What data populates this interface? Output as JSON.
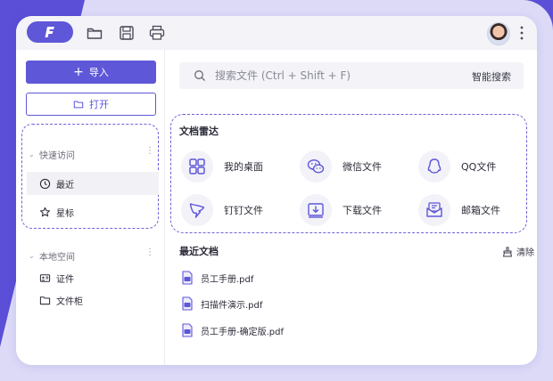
{
  "colors": {
    "accent": "#5e57d8",
    "background_purple": "#5a4fd6",
    "background_light": "#dcdaf7"
  },
  "titlebar": {
    "logo_letter": "F",
    "icons": [
      "folder-icon",
      "save-icon",
      "print-icon"
    ]
  },
  "sidebar": {
    "import_label": "导入",
    "open_label": "打开",
    "quick_access": {
      "title": "快速访问",
      "items": [
        {
          "label": "最近",
          "icon": "clock-icon",
          "active": true
        },
        {
          "label": "星标",
          "icon": "star-icon",
          "active": false
        }
      ]
    },
    "local_space": {
      "title": "本地空间",
      "items": [
        {
          "label": "证件",
          "icon": "id-card-icon"
        },
        {
          "label": "文件柜",
          "icon": "folder-icon"
        }
      ]
    }
  },
  "search": {
    "placeholder": "搜索文件 (Ctrl + Shift + F)",
    "smart_search_label": "智能搜索"
  },
  "radar": {
    "title": "文档雷达",
    "items": [
      {
        "label": "我的桌面",
        "icon": "desktop-grid-icon"
      },
      {
        "label": "微信文件",
        "icon": "wechat-icon"
      },
      {
        "label": "QQ文件",
        "icon": "qq-icon"
      },
      {
        "label": "钉钉文件",
        "icon": "dingtalk-icon"
      },
      {
        "label": "下载文件",
        "icon": "download-icon"
      },
      {
        "label": "邮箱文件",
        "icon": "mail-icon"
      }
    ]
  },
  "recent": {
    "title": "最近文档",
    "clear_label": "清除",
    "files": [
      {
        "name": "员工手册.pdf"
      },
      {
        "name": "扫描件演示.pdf"
      },
      {
        "name": "员工手册-确定版.pdf"
      }
    ]
  }
}
